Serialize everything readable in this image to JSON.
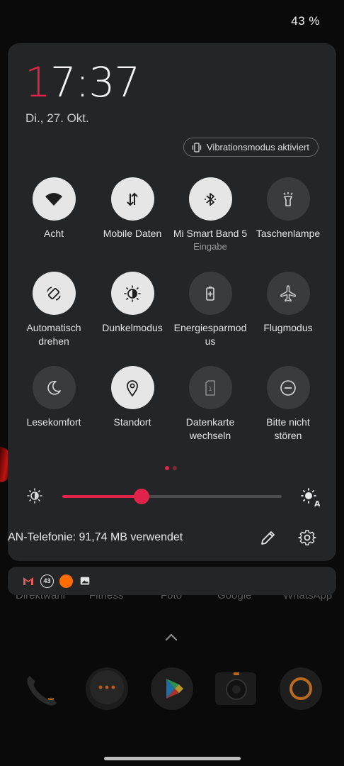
{
  "status_bar": {
    "battery": "43 %"
  },
  "header": {
    "clock_first": "1",
    "clock_rest": "7:37",
    "date": "Di., 27. Okt.",
    "vibration_chip": "Vibrationsmodus aktiviert"
  },
  "tiles": [
    {
      "label": "Acht",
      "icon": "wifi-icon",
      "active": true
    },
    {
      "label": "Mobile Daten",
      "icon": "mobile-data-icon",
      "active": true
    },
    {
      "label": "Mi Smart Band 5",
      "sublabel": "Eingabe",
      "icon": "bluetooth-icon",
      "active": true
    },
    {
      "label": "Taschenlampe",
      "icon": "flashlight-icon",
      "active": false
    },
    {
      "label_line1": "Automatisch",
      "label_line2": "drehen",
      "icon": "auto-rotate-icon",
      "active": true
    },
    {
      "label": "Dunkelmodus",
      "icon": "dark-mode-icon",
      "active": true
    },
    {
      "label_line1": "Energiesparmod",
      "label_line2": "us",
      "icon": "battery-saver-icon",
      "active": false
    },
    {
      "label": "Flugmodus",
      "icon": "airplane-icon",
      "active": false
    },
    {
      "label": "Lesekomfort",
      "icon": "moon-icon",
      "active": false
    },
    {
      "label": "Standort",
      "icon": "location-icon",
      "active": true
    },
    {
      "label_line1": "Datenkarte",
      "label_line2": "wechseln",
      "icon": "sim-card-icon",
      "active": false
    },
    {
      "label_line1": "Bitte nicht",
      "label_line2": "stören",
      "icon": "do-not-disturb-icon",
      "active": false
    }
  ],
  "pager": {
    "active_color": "#e0234a",
    "inactive_color": "#7a2a3a"
  },
  "brightness": {
    "level": 0.36,
    "accent": "#e0234a"
  },
  "footer": {
    "data_usage": "AN-Telefonie: 91,74 MB verwendet"
  },
  "notifications": {
    "icons": [
      "gmail-icon",
      "badge-43-icon",
      "orange-dot-icon",
      "image-icon"
    ],
    "badge_text": "43"
  },
  "dock_labels": [
    "Direktwahl",
    "Fitness",
    "Foto",
    "Google",
    "WhatsApp"
  ],
  "dock_icons": [
    "phone-icon",
    "messages-icon",
    "play-store-icon",
    "camera-icon",
    "browser-icon"
  ]
}
